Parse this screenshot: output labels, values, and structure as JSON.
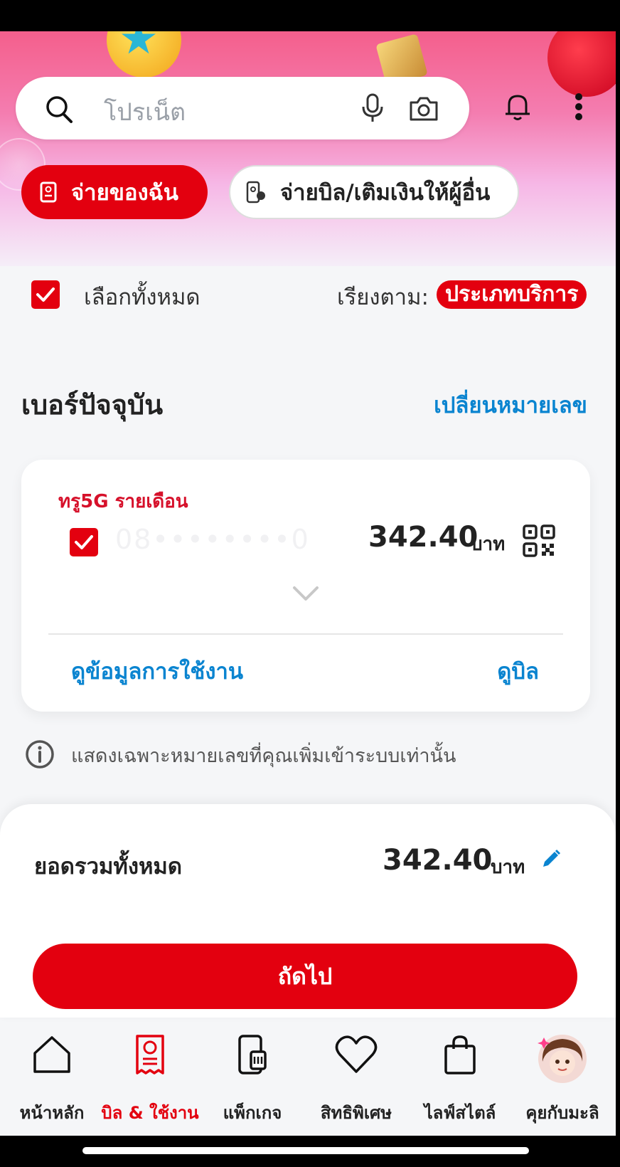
{
  "search": {
    "placeholder": "โปรเน็ต"
  },
  "icons": [
    "search-icon",
    "mic-icon",
    "camera-icon",
    "bell-icon",
    "more-vertical-icon",
    "bill-icon",
    "pay-others-icon",
    "check-icon",
    "qr-code-icon",
    "chevron-down-icon",
    "info-icon",
    "edit-pencil-icon",
    "home-icon",
    "bill-usage-icon",
    "package-sim-icon",
    "heart-icon",
    "shopping-bag-icon",
    "assistant-avatar"
  ],
  "actions": {
    "my_pay": "จ่ายของฉัน",
    "pay_others": "จ่ายบิล/เติมเงินให้ผู้อื่น"
  },
  "selection": {
    "select_all": "เลือกทั้งหมด",
    "sort_label": "เรียงตาม:",
    "sort_value": "ประเภทบริการ"
  },
  "section": {
    "title": "เบอร์ปัจจุบัน",
    "change_number": "เปลี่ยนหมายเลข"
  },
  "account_card": {
    "plan": "ทรู5G รายเดือน",
    "number": "08••••••••0",
    "amount": "342.40",
    "unit": "บาท",
    "view_usage": "ดูข้อมูลการใช้งาน",
    "view_bill": "ดูบิล"
  },
  "info": {
    "text": "แสดงเฉพาะหมายเลขที่คุณเพิ่มเข้าระบบเท่านั้น"
  },
  "summary": {
    "label": "ยอดรวมทั้งหมด",
    "amount": "342.40",
    "unit": "บาท",
    "next": "ถัดไป"
  },
  "tabs": [
    {
      "label": "หน้าหลัก"
    },
    {
      "label": "บิล & ใช้งาน"
    },
    {
      "label": "แพ็กเกจ"
    },
    {
      "label": "สิทธิพิเศษ"
    },
    {
      "label": "ไลฟ์สไตล์"
    },
    {
      "label": "คุยกับมะลิ"
    }
  ],
  "colors": {
    "accent": "#e3000f",
    "link": "#0a84d0"
  }
}
